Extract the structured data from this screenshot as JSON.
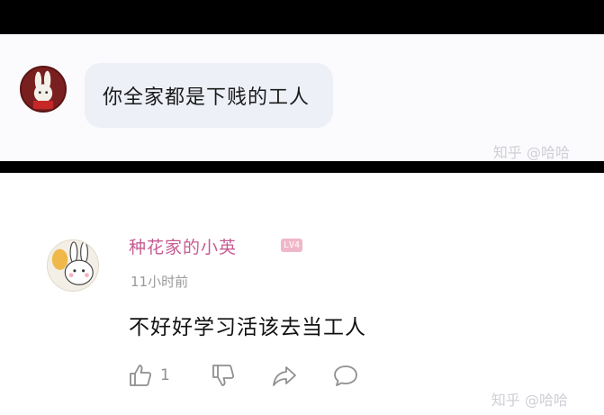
{
  "chat": {
    "message": "你全家都是下贱的工人",
    "watermark": "知乎 @哈哈"
  },
  "comment": {
    "username": "种花家的小英",
    "badge": "LV4",
    "time": "11小时前",
    "text": "不好好学习活该去当工人",
    "likes": "1",
    "watermark": "知乎 @哈哈"
  },
  "icons": {
    "like": "thumbs-up-icon",
    "dislike": "thumbs-down-icon",
    "share": "share-icon",
    "reply": "comment-bubble-icon"
  }
}
